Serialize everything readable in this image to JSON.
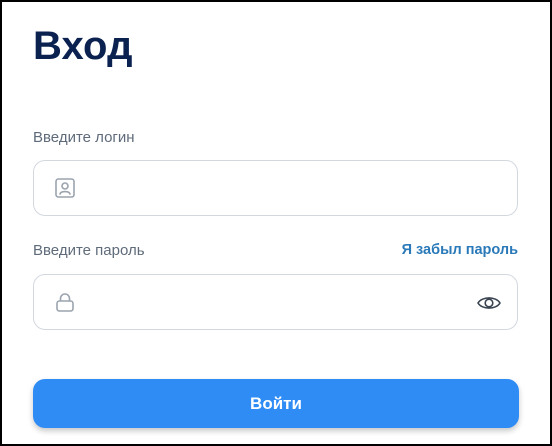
{
  "login_form": {
    "title": "Вход",
    "login_label": "Введите логин",
    "login_value": "",
    "login_placeholder": "",
    "login_icon": "user-card-icon",
    "password_label": "Введите пароль",
    "password_value": "",
    "password_placeholder": "",
    "password_icon": "lock-icon",
    "show_password_icon": "eye-icon",
    "forgot_link": "Я забыл пароль",
    "submit_label": "Войти"
  },
  "colors": {
    "title": "#0b2150",
    "label": "#5f6b7a",
    "link": "#2a79b8",
    "field_border": "#d3d8df",
    "icon": "#9aa3ae",
    "button": "#2f8cf5",
    "button_text": "#ffffff"
  }
}
